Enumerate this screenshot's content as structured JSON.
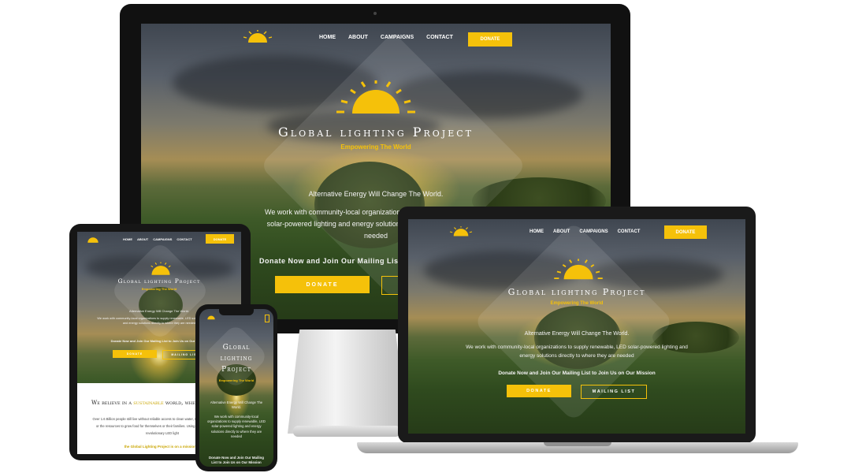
{
  "nav": {
    "home": "HOME",
    "about": "ABOUT",
    "campaigns": "CAMPAIGNS",
    "contact": "CONTACT",
    "donate": "DONATE"
  },
  "hero": {
    "title": "Global lighting Project",
    "title_phone_1": "Global",
    "title_phone_2": "lighting",
    "title_phone_3": "Project",
    "subtitle": "Empowering The World",
    "tagline": "Alternative Energy Will Change The World.",
    "desc_monitor_1": "We work with community-local organizations to supply renewable, LED",
    "desc_monitor_2": "solar-powered lighting and energy solutions directly to where they are",
    "desc_monitor_3": "needed",
    "desc_laptop_1": "We work with community-local organizations to supply renewable, LED solar-powered lighting and",
    "desc_laptop_2": "energy solutions directly to where they are needed",
    "desc_tablet": "We work with community-local organizations to supply renewable, LED solar-powered lighting and energy solutions directly to where they are needed",
    "desc_phone": "We work with community-local organizations to supply renewable, LED solar-powered lighting and energy solutions directly to where they are needed",
    "cta_text": "Donate Now and Join Our Mailing List to Join Us on Our Mission",
    "cta_monitor_partial": "Donate Now and Join Our Mailing List",
    "cta_phone": "Donate Now and Join Our Mailing List to Join Us on Our Mission",
    "donate_button": "DONATE",
    "mailing_button": "MAILING LIST"
  },
  "tablet_section": {
    "heading_pre": "We believe in a",
    "heading_highlight": "sustainable",
    "heading_post": "world, where",
    "para": "Over 1.6 Billion people still live without reliable access to clean water, sanitary cooking facilities, or the resources to grow food for themselves or their families. Using renewable energy and revolutionary LED light",
    "highlight_line": "the Global Lighting Project is on a mission to"
  },
  "colors": {
    "accent": "#f5c10a",
    "dark": "#111111"
  }
}
